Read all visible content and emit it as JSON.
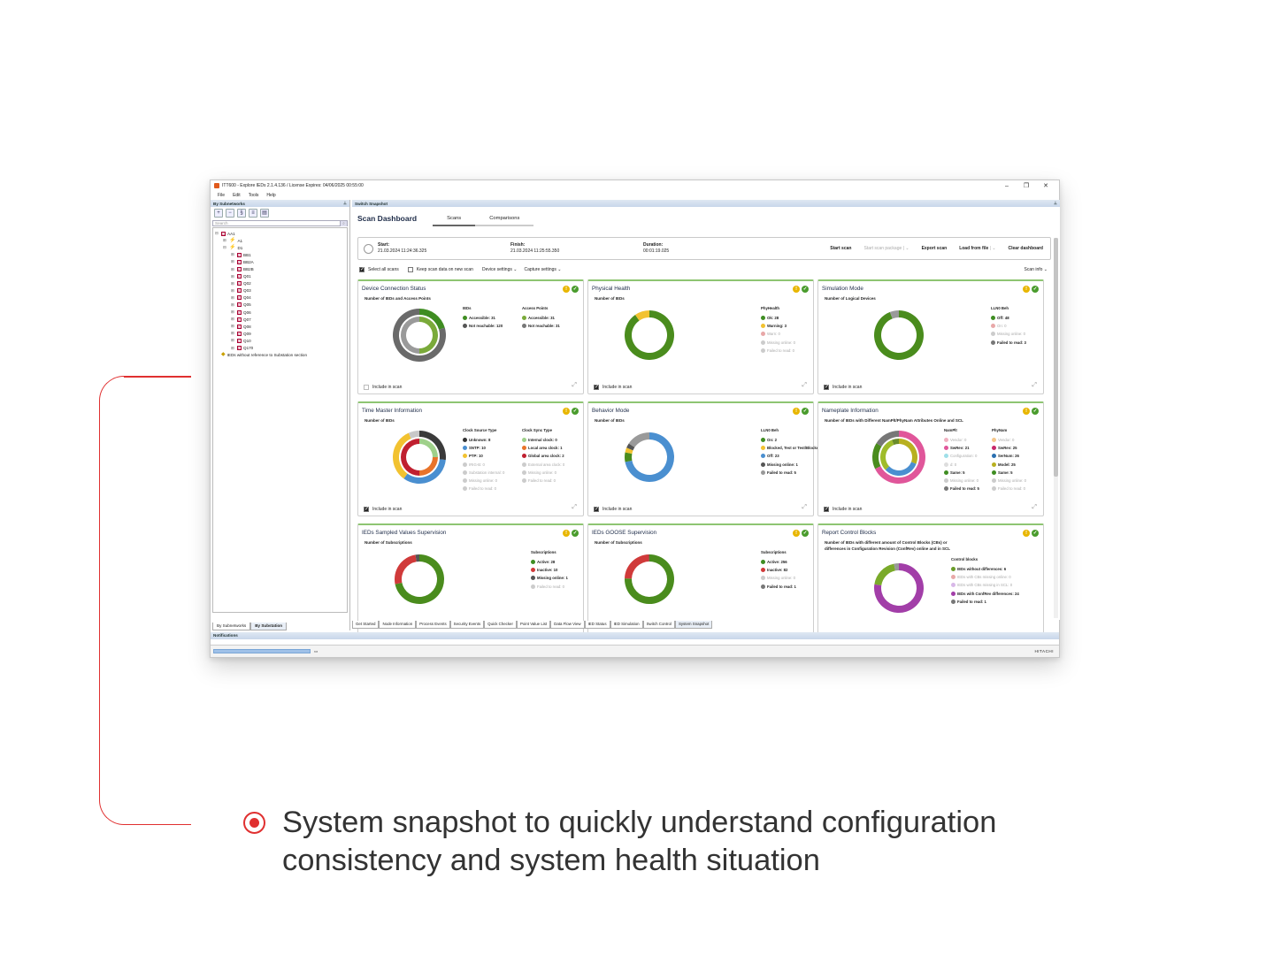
{
  "window": {
    "title": "ITT600 - Explore IEDs 2.1.4.136 / License Expires: 04/06/2025 00:55:00",
    "controls": [
      "–",
      "❐",
      "✕"
    ]
  },
  "menu": [
    "File",
    "Edit",
    "Tools",
    "Help"
  ],
  "left_panel": {
    "header": "By Subnetworks",
    "search_placeholder": "Search",
    "tree": [
      {
        "d": 0,
        "label": "AA1",
        "x": "⊟"
      },
      {
        "d": 1,
        "label": "A1",
        "x": "⊞"
      },
      {
        "d": 1,
        "label": "D1",
        "x": "⊟"
      },
      {
        "d": 2,
        "label": "BB1"
      },
      {
        "d": 2,
        "label": "BB2A"
      },
      {
        "d": 2,
        "label": "BB2B"
      },
      {
        "d": 2,
        "label": "Q01"
      },
      {
        "d": 2,
        "label": "Q02"
      },
      {
        "d": 2,
        "label": "Q03"
      },
      {
        "d": 2,
        "label": "Q04"
      },
      {
        "d": 2,
        "label": "Q05"
      },
      {
        "d": 2,
        "label": "Q06"
      },
      {
        "d": 2,
        "label": "Q07"
      },
      {
        "d": 2,
        "label": "Q08"
      },
      {
        "d": 2,
        "label": "Q09"
      },
      {
        "d": 2,
        "label": "Q10"
      },
      {
        "d": 2,
        "label": "Q170"
      },
      {
        "d": 0,
        "label": "IEDs without reference to Substation section",
        "x": ""
      }
    ],
    "tabs": [
      "By Subnetworks",
      "By Substation"
    ]
  },
  "right_panel": {
    "header": "Switch Snapshot"
  },
  "dashboard": {
    "title": "Scan Dashboard",
    "tabs": [
      "Scans",
      "Comparisons"
    ],
    "start_label": "Start:",
    "start": "21.03.2024 11:24:36.325",
    "finish_label": "Finish:",
    "finish": "21.03.2024 11:25:55.350",
    "duration_label": "Duration:",
    "duration": "00:01:19.025",
    "buttons": {
      "start": "Start scan",
      "package": "Start scan package",
      "export": "Export scan",
      "load": "Load from file",
      "clear": "Clear dashboard"
    },
    "options": {
      "select_all": "Select all scans",
      "keep": "Keep scan data on new scan",
      "device": "Device settings",
      "capture": "Capture settings",
      "scan_info": "Scan info"
    },
    "include": "Include in scan"
  },
  "cards": [
    {
      "title": "Device Connection Status",
      "subtitle": "Number of IEDs and Access Points",
      "include": false,
      "rings": [
        [
          {
            "v": 31,
            "c": "#3f8d22"
          },
          {
            "v": 120,
            "c": "#6a6a6a"
          }
        ],
        [
          {
            "v": 31,
            "c": "#7aaa3a"
          },
          {
            "v": 31,
            "c": "#9a9a9a"
          }
        ]
      ],
      "legends": [
        {
          "head": "IEDs",
          "items": [
            {
              "l": "Accessible: 31",
              "c": "#3f8d22"
            },
            {
              "l": "Not reachable: 120",
              "c": "#555"
            }
          ]
        },
        {
          "head": "Access Points",
          "items": [
            {
              "l": "Accessible: 31",
              "c": "#7aaa3a"
            },
            {
              "l": "Not reachable: 31",
              "c": "#777"
            }
          ]
        }
      ]
    },
    {
      "title": "Physical Health",
      "subtitle": "Number of IEDs",
      "include": true,
      "rings": [
        [
          {
            "v": 28,
            "c": "#4a8c1d"
          },
          {
            "v": 3,
            "c": "#f2c230"
          }
        ]
      ],
      "legends": [
        {
          "head": "PhyHealth",
          "items": [
            {
              "l": "Ok: 28",
              "c": "#3f8d22"
            },
            {
              "l": "Warning: 3",
              "c": "#f2c230"
            },
            {
              "l": "Warn: 0",
              "c": "#e8a8a8",
              "m": 1
            },
            {
              "l": "Missing online: 0",
              "c": "#ccc",
              "m": 1
            },
            {
              "l": "Failed to read: 0",
              "c": "#ccc",
              "m": 1
            }
          ]
        }
      ]
    },
    {
      "title": "Simulation Mode",
      "subtitle": "Number of Logical Devices",
      "include": true,
      "rings": [
        [
          {
            "v": 48,
            "c": "#4a8c1d"
          },
          {
            "v": 3,
            "c": "#9a9a9a"
          }
        ]
      ],
      "legends": [
        {
          "head": "LLN0 Beh",
          "items": [
            {
              "l": "Off: 48",
              "c": "#3f8d22"
            },
            {
              "l": "On: 0",
              "c": "#e8a8a8",
              "m": 1
            },
            {
              "l": "Missing online: 0",
              "c": "#ccc",
              "m": 1
            },
            {
              "l": "Failed to read: 3",
              "c": "#777"
            }
          ]
        }
      ]
    },
    {
      "title": "Time Master Information",
      "subtitle": "Number of IEDs",
      "include": true,
      "rings": [
        [
          {
            "v": 8,
            "c": "#3a3a3a"
          },
          {
            "v": 10,
            "c": "#4a8fd0"
          },
          {
            "v": 10,
            "c": "#f2c230"
          },
          {
            "v": 2,
            "c": "#c8c8c8"
          }
        ],
        [
          {
            "v": 1,
            "c": "#9fd08a"
          },
          {
            "v": 1,
            "c": "#e8732a"
          },
          {
            "v": 2,
            "c": "#c02030"
          }
        ]
      ],
      "legends": [
        {
          "head": "Clock Source Type",
          "items": [
            {
              "l": "Unknown: 8",
              "c": "#333"
            },
            {
              "l": "SNTP: 10",
              "c": "#4a8fd0"
            },
            {
              "l": "PTP: 10",
              "c": "#f2c230"
            },
            {
              "l": "IRIG-B: 0",
              "c": "#ccc",
              "m": 1
            },
            {
              "l": "Substation internal: 0",
              "c": "#ccc",
              "m": 1
            },
            {
              "l": "Missing online: 0",
              "c": "#ccc",
              "m": 1
            },
            {
              "l": "Failed to read: 0",
              "c": "#ccc",
              "m": 1
            }
          ]
        },
        {
          "head": "Clock Sync Type",
          "items": [
            {
              "l": "Internal clock: 0",
              "c": "#9fd08a"
            },
            {
              "l": "Local area clock: 1",
              "c": "#e8732a"
            },
            {
              "l": "Global area clock: 2",
              "c": "#c02030"
            },
            {
              "l": "External area clock: 0",
              "c": "#ccc",
              "m": 1
            },
            {
              "l": "Missing online: 0",
              "c": "#ccc",
              "m": 1
            },
            {
              "l": "Failed to read: 0",
              "c": "#ccc",
              "m": 1
            }
          ]
        }
      ]
    },
    {
      "title": "Behavior Mode",
      "subtitle": "Number of IEDs",
      "include": true,
      "rings": [
        [
          {
            "v": 23,
            "c": "#4a8fd0"
          },
          {
            "v": 2,
            "c": "#4a8c1d"
          },
          {
            "v": 1,
            "c": "#f2c230"
          },
          {
            "v": 1,
            "c": "#555"
          },
          {
            "v": 5,
            "c": "#9a9a9a"
          }
        ]
      ],
      "legends": [
        {
          "head": "LLN0 Beh",
          "items": [
            {
              "l": "On: 2",
              "c": "#3f8d22"
            },
            {
              "l": "Blocked, Test or Test/Blocked: 1",
              "c": "#f2c230"
            },
            {
              "l": "Off: 23",
              "c": "#4a8fd0"
            },
            {
              "l": "Missing online: 1",
              "c": "#555"
            },
            {
              "l": "Failed to read: 5",
              "c": "#999"
            }
          ]
        }
      ]
    },
    {
      "title": "Nameplate Information",
      "subtitle": "Number of IEDs with Different NamPlt/PhyNam Attributes Online and SCL",
      "include": true,
      "rings": [
        [
          {
            "v": 21,
            "c": "#e0569a"
          },
          {
            "v": 5,
            "c": "#4a8c1d"
          },
          {
            "v": 5,
            "c": "#777"
          }
        ],
        [
          {
            "v": 25,
            "c": "#b8b020"
          },
          {
            "v": 26,
            "c": "#4a8fd0"
          },
          {
            "v": 25,
            "c": "#9fbc2a"
          },
          {
            "v": 5,
            "c": "#6a8c2a"
          }
        ]
      ],
      "legends": [
        {
          "head": "NamPlt",
          "items": [
            {
              "l": "Vendor: 0",
              "c": "#f0b0c0",
              "m": 1
            },
            {
              "l": "SwRev: 21",
              "c": "#e0569a"
            },
            {
              "l": "Configuration: 0",
              "c": "#9fdfe8",
              "m": 1
            },
            {
              "l": "d: 0",
              "c": "#ddd",
              "m": 1
            },
            {
              "l": "Same: 5",
              "c": "#3f8d22"
            },
            {
              "l": "Missing online: 0",
              "c": "#ccc",
              "m": 1
            },
            {
              "l": "Failed to read: 5",
              "c": "#777"
            }
          ]
        },
        {
          "head": "PhyNam",
          "items": [
            {
              "l": "Vendor: 0",
              "c": "#f5c78a",
              "m": 1
            },
            {
              "l": "SwRev: 25",
              "c": "#c8286a"
            },
            {
              "l": "SerNum: 26",
              "c": "#2a6fb0"
            },
            {
              "l": "Model: 25",
              "c": "#b8b020"
            },
            {
              "l": "Same: 5",
              "c": "#3f8d22"
            },
            {
              "l": "Missing online: 0",
              "c": "#ccc",
              "m": 1
            },
            {
              "l": "Failed to read: 0",
              "c": "#ccc",
              "m": 1
            }
          ]
        }
      ]
    },
    {
      "title": "IEDs Sampled Values Supervision",
      "subtitle": "Number of Subscriptions",
      "include": null,
      "rings": [
        [
          {
            "v": 28,
            "c": "#4a8c1d"
          },
          {
            "v": 10,
            "c": "#d03a3a"
          },
          {
            "v": 1,
            "c": "#555"
          }
        ]
      ],
      "legends": [
        {
          "head": "Subscriptions",
          "items": [
            {
              "l": "Active: 28",
              "c": "#3f8d22"
            },
            {
              "l": "Inactive: 10",
              "c": "#d03a3a"
            },
            {
              "l": "Missing online: 1",
              "c": "#555"
            },
            {
              "l": "Failed to read: 0",
              "c": "#ccc",
              "m": 1
            }
          ]
        }
      ]
    },
    {
      "title": "IEDs GOOSE Supervision",
      "subtitle": "Number of Subscriptions",
      "include": null,
      "rings": [
        [
          {
            "v": 256,
            "c": "#4a8c1d"
          },
          {
            "v": 82,
            "c": "#d03a3a"
          },
          {
            "v": 1,
            "c": "#555"
          }
        ]
      ],
      "legends": [
        {
          "head": "Subscriptions",
          "items": [
            {
              "l": "Active: 256",
              "c": "#3f8d22"
            },
            {
              "l": "Inactive: 82",
              "c": "#d03a3a"
            },
            {
              "l": "Missing online: 0",
              "c": "#ccc",
              "m": 1
            },
            {
              "l": "Failed to read: 1",
              "c": "#777"
            }
          ]
        }
      ]
    },
    {
      "title": "Report Control Blocks",
      "subtitle": "Number of IEDs with different amount of Control Blocks (CBs) or differences in Configuration Revision (ConfRev) online and in SCL",
      "include": null,
      "rings": [
        [
          {
            "v": 24,
            "c": "#a23ea8"
          },
          {
            "v": 6,
            "c": "#7aaa2a"
          },
          {
            "v": 1,
            "c": "#999"
          }
        ]
      ],
      "legends": [
        {
          "head": "Control blocks",
          "items": [
            {
              "l": "IEDs without differences: 6",
              "c": "#6a9c2a"
            },
            {
              "l": "IEDs with CBs missing online: 0",
              "c": "#e8a8a8",
              "m": 1
            },
            {
              "l": "IEDs with CBs missing in SCL: 0",
              "c": "#d8b8e8",
              "m": 1
            },
            {
              "l": "IEDs with ConfRev differences: 24",
              "c": "#a23ea8"
            },
            {
              "l": "Failed to read: 1",
              "c": "#777"
            }
          ]
        }
      ]
    }
  ],
  "bottom_tabs": [
    "Get Started",
    "Node Information",
    "Process Events",
    "Security Events",
    "Quick Checker",
    "Point Value List",
    "Data Flow View",
    "IED Status",
    "IED Simulation",
    "Switch Control",
    "System Snapshot"
  ],
  "notifications": "Notifications",
  "brand": "HITACHI",
  "caption": {
    "line1": "System snapshot to quickly understand configuration",
    "line2": "consistency and system health situation"
  },
  "colors": {
    "accent": "#e03030",
    "ok": "#4a8c1d",
    "header": "#1d2b48"
  }
}
